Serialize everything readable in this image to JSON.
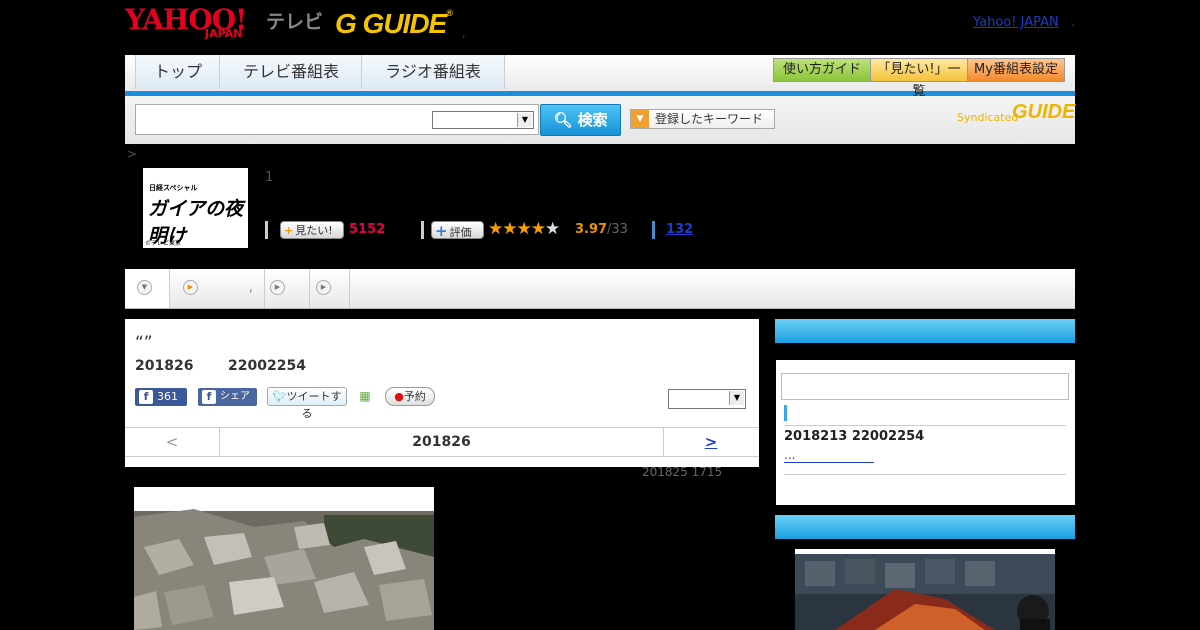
{
  "header": {
    "yahoo_logo": "YAHOO!",
    "yahoo_japan": "JAPAN",
    "tv_label": "テレビ",
    "gguide_logo": "G GUIDE",
    "dot": ",",
    "yahoo_japan_link": "Yahoo! JAPAN",
    "link_dot": "."
  },
  "nav": {
    "tabs": [
      "トップ",
      "テレビ番組表",
      "ラジオ番組表"
    ],
    "buttons": [
      "使い方ガイド",
      "「見たい!」一覧",
      "My番組表設定"
    ]
  },
  "search": {
    "button_label": "検索",
    "keyword_button": "登録したキーワード",
    "syndicated": "Syndicated",
    "syndicated_logo": "GUIDE"
  },
  "breadcrumb": ">",
  "program": {
    "thumb_top": "日経スペシャル",
    "thumb_title": "ガイアの夜明け",
    "thumb_copy": "©テレビ東京",
    "episode_label": "1",
    "mitai_label": "見たい!",
    "mitai_count": "5152",
    "rate_label": "評価",
    "rating": "3.97",
    "rating_count": "/33",
    "link_count": "132",
    "star_full": "★★★★",
    "star_empty": "★"
  },
  "tabs": {
    "second_dot": ","
  },
  "episode": {
    "quote": "“”",
    "date": "201826",
    "time": "22002254",
    "like_count": "361",
    "share_label": "シェア",
    "tweet_label": "ツイートする",
    "reserve_label": "予約",
    "pager_prev": "<",
    "pager_date": "201826",
    "pager_next": ">",
    "update_note": "201825  1715"
  },
  "sidebar": {
    "date": "2018213  22002254",
    "more": "..."
  },
  "colors": {
    "accent_blue": "#1a8fe0",
    "mitai_red": "#e6004a",
    "rating_orange": "#e89200"
  }
}
